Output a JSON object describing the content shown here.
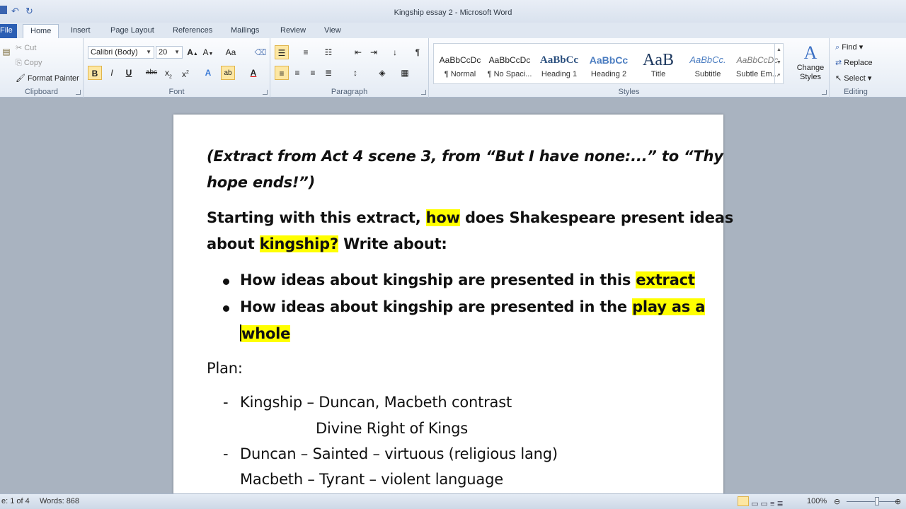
{
  "window": {
    "title": "Kingship essay 2  -  Microsoft Word"
  },
  "tabs": [
    "File",
    "Home",
    "Insert",
    "Page Layout",
    "References",
    "Mailings",
    "Review",
    "View"
  ],
  "active_tab": "Home",
  "ribbon": {
    "clipboard": {
      "label": "Clipboard",
      "cut": "Cut",
      "copy": "Copy",
      "format_painter": "Format Painter"
    },
    "font": {
      "label": "Font",
      "font_name": "Calibri (Body)",
      "font_size": "20"
    },
    "paragraph": {
      "label": "Paragraph"
    },
    "styles": {
      "label": "Styles",
      "items": [
        {
          "preview": "AaBbCcDc",
          "name": "¶ Normal"
        },
        {
          "preview": "AaBbCcDc",
          "name": "¶ No Spaci..."
        },
        {
          "preview": "AaBbCc",
          "name": "Heading 1"
        },
        {
          "preview": "AaBbCc",
          "name": "Heading 2"
        },
        {
          "preview": "AaB",
          "name": "Title"
        },
        {
          "preview": "AaBbCc.",
          "name": "Subtitle"
        },
        {
          "preview": "AaBbCcDc",
          "name": "Subtle Em..."
        }
      ],
      "change_styles": "Change Styles"
    },
    "editing": {
      "label": "Editing",
      "find": "Find",
      "replace": "Replace",
      "select": "Select"
    }
  },
  "document": {
    "line1": "(Extract from Act 4 scene 3, from “But I have none:...” to “Thy",
    "line2": "hope ends!”)",
    "q1_pre": "Starting with this extract, ",
    "q1_hl": "how",
    "q1_post": " does Shakespeare present ideas",
    "q2_pre": "about ",
    "q2_hl": "kingship?",
    "q2_post": " Write about:",
    "b1_pre": "How ideas about kingship are presented in this ",
    "b1_hl": "extract",
    "b2_pre": "How ideas about kingship are presented in the ",
    "b2_hl": "play as a",
    "b2_cont": "whole",
    "plan": "Plan:",
    "plan1": "Kingship – Duncan, Macbeth contrast",
    "plan1b": "Divine Right of Kings",
    "plan2": "Duncan – Sainted – virtuous (religious lang)",
    "plan2b": "Macbeth – Tyrant – violent language",
    "dash": "-"
  },
  "status": {
    "page": "e: 1 of 4",
    "words": "Words: 868",
    "zoom": "100%"
  },
  "colors": {
    "highlight": "#ffff00",
    "file_tab": "#2b5fb4"
  }
}
